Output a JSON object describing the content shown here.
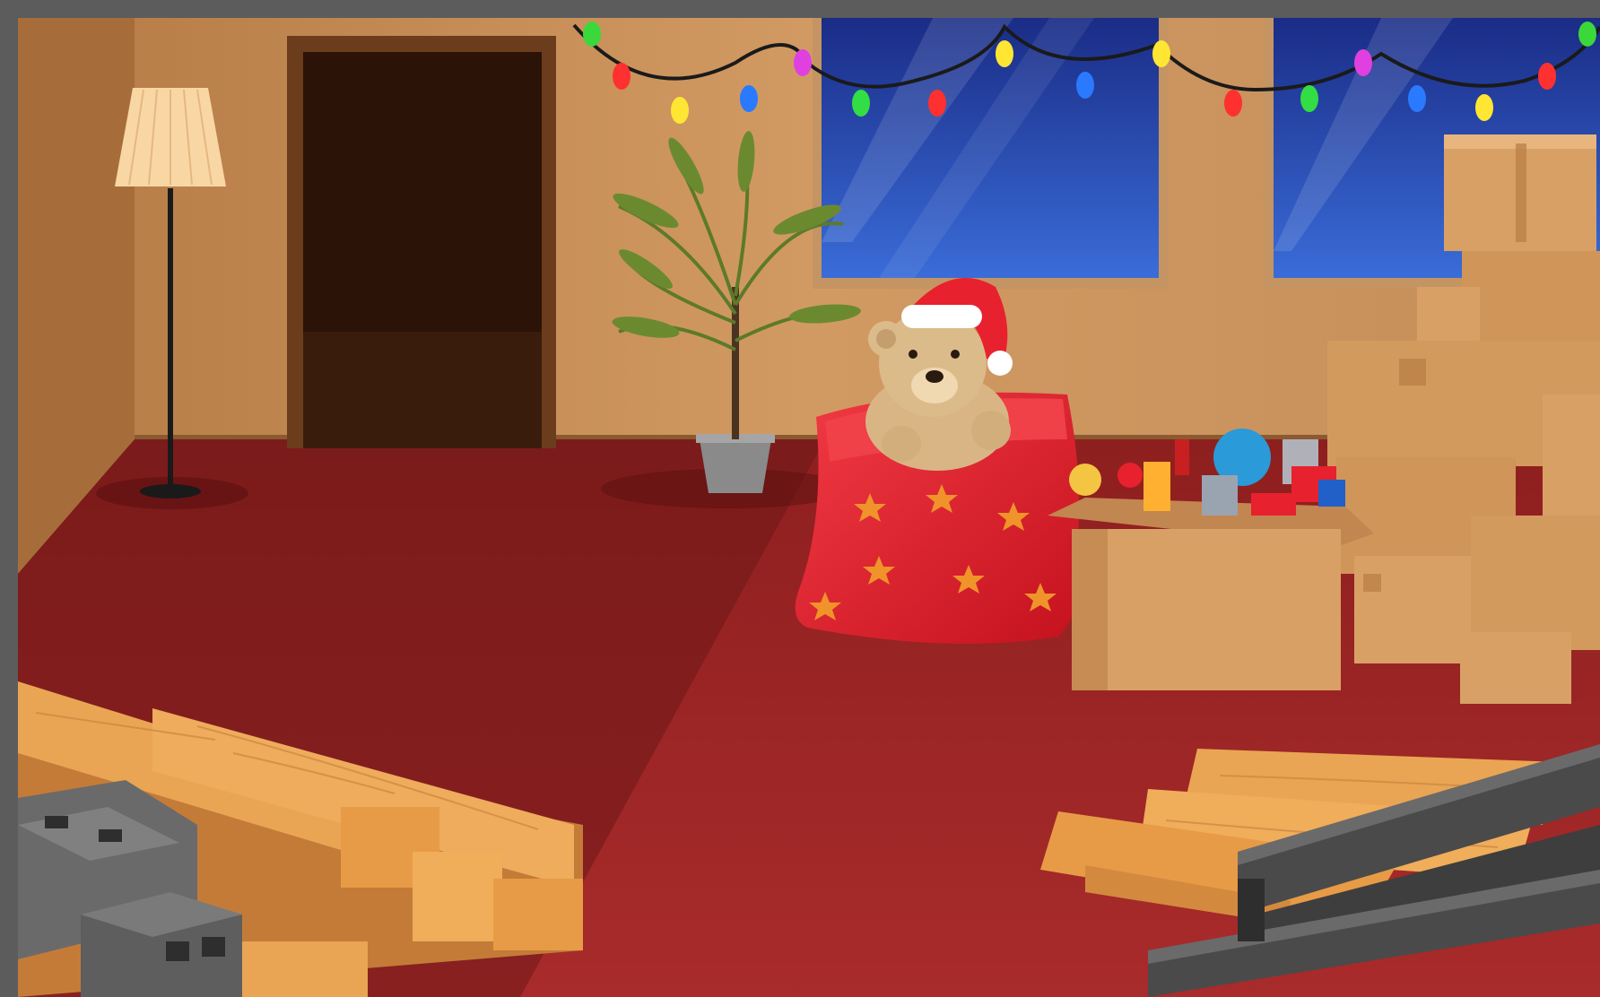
{
  "scene": {
    "name": "christmas-toy-room",
    "colors": {
      "wall": "#c88f5a",
      "wall_shadow": "#9a6a3e",
      "floor": "#a82a2a",
      "floor_dark": "#6e1818",
      "sack": "#e8212e",
      "star": "#f0932a",
      "window_sky": "#1e3a9a",
      "box": "#d9a066",
      "wood": "#e9a553",
      "steel": "#4a4a4a",
      "cinder": "#6a6a6a"
    },
    "objects": [
      {
        "name": "floor-lamp",
        "icon": "lamp-icon"
      },
      {
        "name": "doorway",
        "icon": "door-icon"
      },
      {
        "name": "potted-palm",
        "icon": "plant-icon"
      },
      {
        "name": "window-left",
        "icon": "window-icon"
      },
      {
        "name": "window-right",
        "icon": "window-icon"
      },
      {
        "name": "christmas-lights",
        "icon": "string-lights-icon"
      },
      {
        "name": "santa-sack",
        "icon": "sack-icon"
      },
      {
        "name": "teddy-bear",
        "icon": "teddy-bear-icon"
      },
      {
        "name": "toy-box",
        "icon": "toy-box-icon"
      },
      {
        "name": "cardboard-box-stack",
        "icon": "box-icon"
      },
      {
        "name": "lumber-pile-left",
        "icon": "lumber-icon"
      },
      {
        "name": "cinder-blocks",
        "icon": "cinder-block-icon"
      },
      {
        "name": "plank-pile-right",
        "icon": "plank-icon"
      },
      {
        "name": "steel-beams",
        "icon": "steel-beam-icon"
      }
    ]
  }
}
